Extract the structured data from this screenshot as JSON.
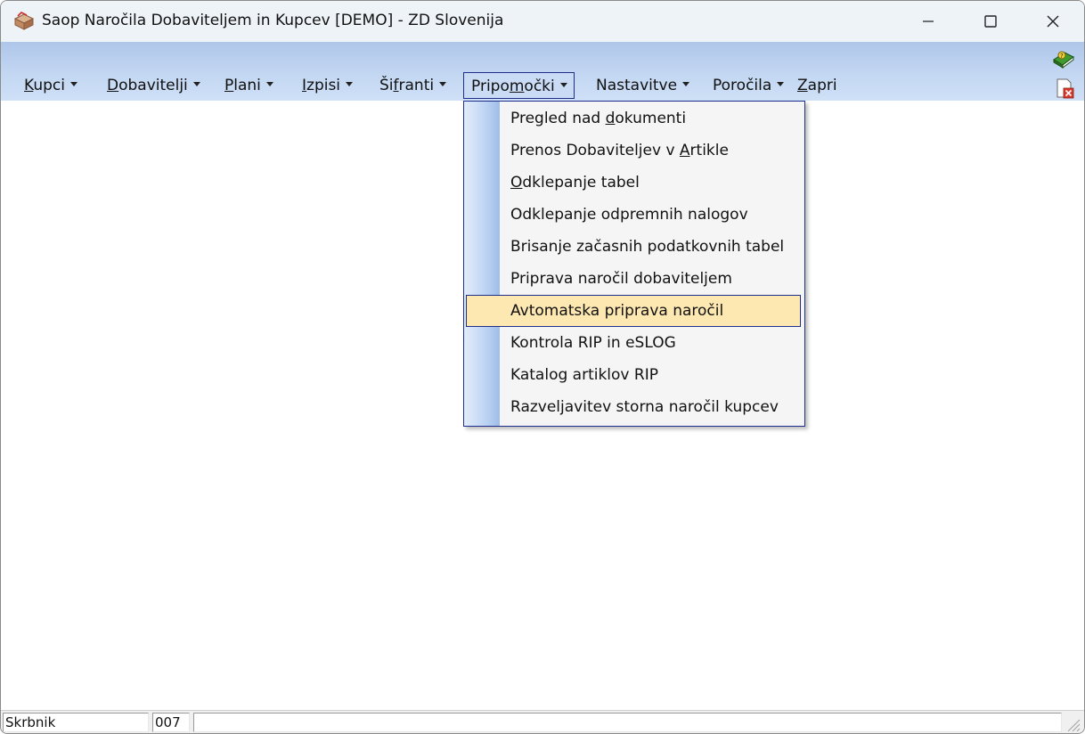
{
  "window": {
    "title": "Saop Naročila Dobaviteljem in Kupcev [DEMO] - ZD Slovenija"
  },
  "menubar": {
    "items": [
      {
        "pre": "",
        "acc": "K",
        "post": "upci"
      },
      {
        "pre": "",
        "acc": "D",
        "post": "obavitelji"
      },
      {
        "pre": "",
        "acc": "P",
        "post": "lani"
      },
      {
        "pre": "",
        "acc": "I",
        "post": "zpisi"
      },
      {
        "pre": "Ši",
        "acc": "f",
        "post": "ranti"
      },
      {
        "pre": "Pripo",
        "acc": "m",
        "post": "očki"
      },
      {
        "pre": "Nastavitve",
        "acc": "",
        "post": ""
      },
      {
        "pre": "Poročila",
        "acc": "",
        "post": ""
      },
      {
        "pre": "",
        "acc": "Z",
        "post": "apri"
      }
    ]
  },
  "dropdown": {
    "items": [
      {
        "pre": "Pregled nad ",
        "acc": "d",
        "post": "okumenti"
      },
      {
        "pre": "Prenos Dobaviteljev v ",
        "acc": "A",
        "post": "rtikle"
      },
      {
        "pre": "",
        "acc": "O",
        "post": "dklepanje tabel"
      },
      {
        "pre": "Odklepanje odpremnih nalogov",
        "acc": "",
        "post": ""
      },
      {
        "pre": "Brisanje začasnih podatkovnih tabel",
        "acc": "",
        "post": ""
      },
      {
        "pre": "Priprava naročil dobaviteljem",
        "acc": "",
        "post": ""
      },
      {
        "pre": "Avtomatska priprava naročil",
        "acc": "",
        "post": ""
      },
      {
        "pre": "Kontrola RIP in eSLOG",
        "acc": "",
        "post": ""
      },
      {
        "pre": "Katalog artiklov RIP",
        "acc": "",
        "post": ""
      },
      {
        "pre": "Razveljavitev storna naročil kupcev",
        "acc": "",
        "post": ""
      }
    ],
    "highlighted_index": 6
  },
  "statusbar": {
    "user": "Skrbnik",
    "code": "007",
    "message": ""
  },
  "colors": {
    "menubar_top": "#aec6ea",
    "highlight_fill": "#fde8b2",
    "focus_border": "#1d2f8a"
  }
}
